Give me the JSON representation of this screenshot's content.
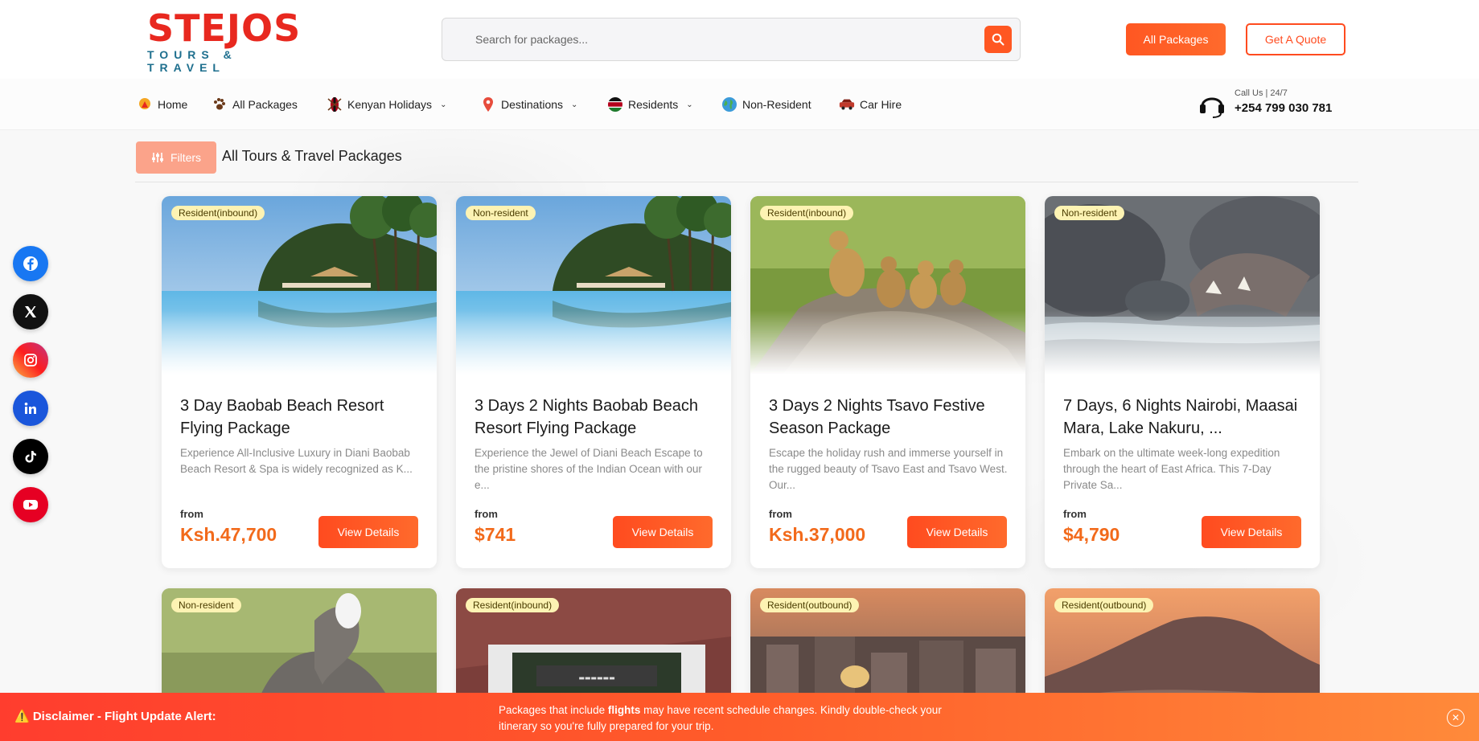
{
  "logo": {
    "name": "STEJOS",
    "tagline": "TOURS & TRAVEL"
  },
  "search": {
    "placeholder": "Search for packages..."
  },
  "header": {
    "all_packages_label": "All Packages",
    "quote_label": "Get A Quote"
  },
  "nav": {
    "items": [
      {
        "label": "Home"
      },
      {
        "label": "All Packages"
      },
      {
        "label": "Kenyan Holidays"
      },
      {
        "label": "Destinations"
      },
      {
        "label": "Residents"
      },
      {
        "label": "Non-Resident"
      },
      {
        "label": "Car Hire"
      }
    ],
    "call_small": "Call Us | 24/7",
    "call_number": "+254 799 030 781"
  },
  "filter": {
    "label": "Filters",
    "title": "All Tours & Travel Packages"
  },
  "social": [
    "facebook-icon",
    "x-icon",
    "instagram-icon",
    "linkedin-icon",
    "tiktok-icon",
    "youtube-icon"
  ],
  "cards": [
    {
      "badge": "Resident(inbound)",
      "title": "3 Day Baobab Beach Resort Flying Package",
      "desc": "Experience All-Inclusive Luxury in Diani Baobab Beach Resort & Spa is widely recognized as K...",
      "from": "from",
      "price": "Ksh.47,700",
      "btn": "View Details"
    },
    {
      "badge": "Non-resident",
      "title": "3 Days 2 Nights Baobab Beach Resort Flying Package",
      "desc": "Experience the Jewel of Diani Beach Escape to the pristine shores of the Indian Ocean with our e...",
      "from": "from",
      "price": "$741",
      "btn": "View Details"
    },
    {
      "badge": "Resident(inbound)",
      "title": "3 Days 2 Nights Tsavo Festive Season Package",
      "desc": "Escape the holiday rush and immerse yourself in the rugged beauty of Tsavo East and Tsavo West. Our...",
      "from": "from",
      "price": "Ksh.37,000",
      "btn": "View Details"
    },
    {
      "badge": "Non-resident",
      "title": "7 Days, 6 Nights Nairobi, Maasai Mara, Lake Nakuru, ...",
      "desc": "Embark on the ultimate week-long expedition through the heart of East Africa. This 7-Day Private Sa...",
      "from": "from",
      "price": "$4,790",
      "btn": "View Details"
    }
  ],
  "cards_row2": [
    {
      "badge": "Non-resident"
    },
    {
      "badge": "Resident(inbound)"
    },
    {
      "badge": "Resident(outbound)"
    },
    {
      "badge": "Resident(outbound)"
    }
  ],
  "disclaimer": {
    "title": "⚠️ Disclaimer - Flight Update Alert:",
    "text_pre": "Packages that include ",
    "text_bold": "flights",
    "text_post": " may have recent schedule changes. Kindly double-check your itinerary so you're fully prepared for your trip."
  },
  "colors": {
    "accent": "#ff5722",
    "price": "#f26a1b",
    "badge_bg": "#fdf3b3"
  }
}
